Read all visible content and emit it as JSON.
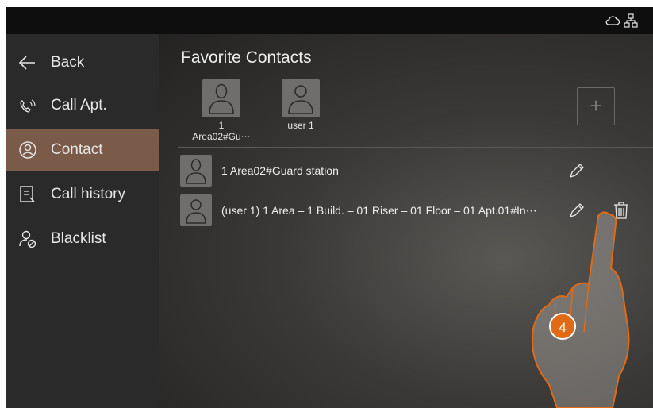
{
  "status_bar": {
    "icons": [
      "cloud-icon",
      "network-icon"
    ]
  },
  "sidebar": {
    "items": [
      {
        "label": "Back",
        "icon": "arrow-left-icon"
      },
      {
        "label": "Call Apt.",
        "icon": "phone-icon"
      },
      {
        "label": "Contact",
        "icon": "contact-icon",
        "active": true
      },
      {
        "label": "Call history",
        "icon": "call-history-icon"
      },
      {
        "label": "Blacklist",
        "icon": "blacklist-icon"
      }
    ]
  },
  "main": {
    "title": "Favorite Contacts",
    "favorites": [
      {
        "line1": "1",
        "line2": "Area02#Gu⋯"
      },
      {
        "line1": "user 1",
        "line2": ""
      }
    ],
    "add_label": "+",
    "contacts": [
      {
        "text": "1 Area02#Guard station"
      },
      {
        "text": "(user 1) 1 Area – 1 Build. – 01 Riser – 01 Floor – 01 Apt.01#In⋯"
      }
    ]
  },
  "annotation": {
    "step_number": "4"
  },
  "colors": {
    "accent": "#e06a16",
    "active_nav": "#7a5a48",
    "sidebar_bg": "#2a2a2a"
  }
}
